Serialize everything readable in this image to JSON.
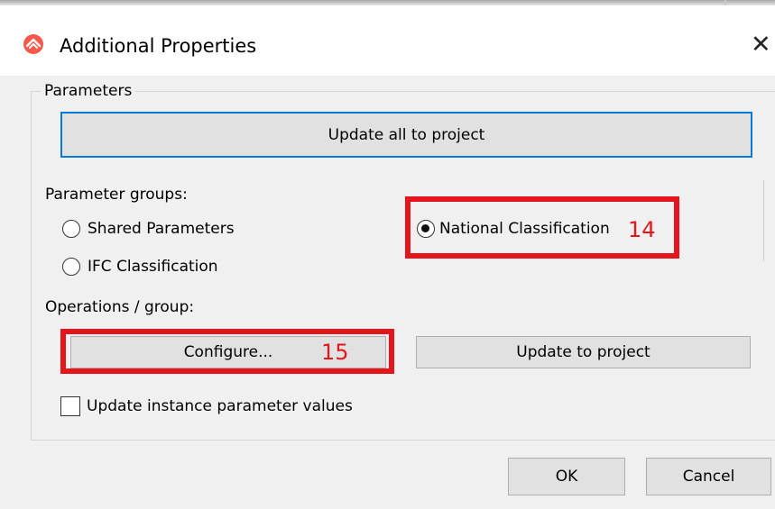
{
  "window": {
    "title": "Additional Properties",
    "close_symbol": "✕",
    "icon": "app-logo-icon"
  },
  "parameters_group": {
    "legend": "Parameters",
    "update_all_button": "Update all to project"
  },
  "parameter_groups": {
    "label": "Parameter groups:",
    "options": [
      {
        "label": "Shared Parameters",
        "selected": false
      },
      {
        "label": "IFC Classification",
        "selected": false
      },
      {
        "label": "National Classification",
        "selected": true
      }
    ]
  },
  "operations": {
    "label": "Operations / group:",
    "configure_button": "Configure...",
    "update_to_project_button": "Update to project",
    "instance_checkbox": {
      "label": "Update instance parameter values",
      "checked": false
    }
  },
  "footer": {
    "ok_label": "OK",
    "cancel_label": "Cancel"
  },
  "annotations": {
    "marker_14": "14",
    "marker_15": "15",
    "color": "#e5151c"
  }
}
